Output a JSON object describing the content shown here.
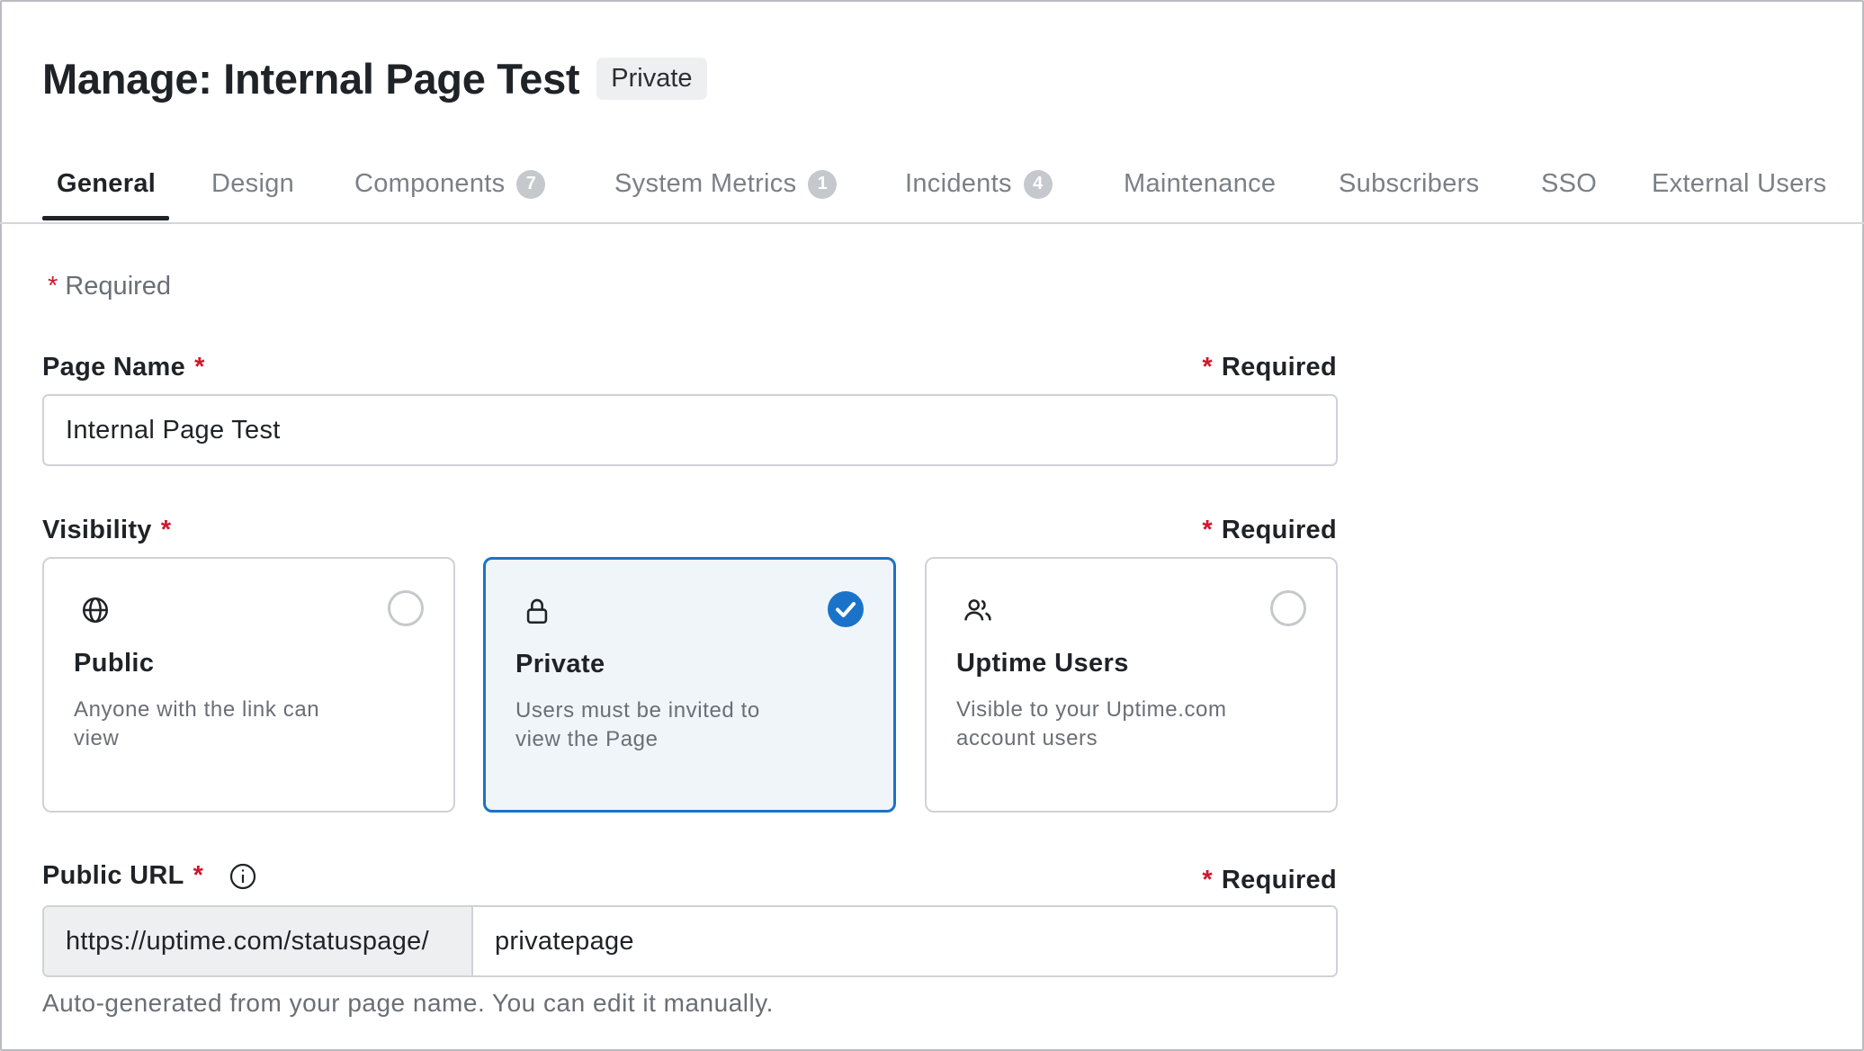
{
  "header": {
    "title": "Manage: Internal Page Test",
    "badge": "Private"
  },
  "tabs": [
    {
      "label": "General",
      "count": null,
      "active": true
    },
    {
      "label": "Design",
      "count": null
    },
    {
      "label": "Components",
      "count": "7"
    },
    {
      "label": "System Metrics",
      "count": "1"
    },
    {
      "label": "Incidents",
      "count": "4"
    },
    {
      "label": "Maintenance",
      "count": null
    },
    {
      "label": "Subscribers",
      "count": null
    },
    {
      "label": "SSO",
      "count": null
    },
    {
      "label": "External Users",
      "count": null
    }
  ],
  "form": {
    "required_note": "Required",
    "required_star": "*",
    "page_name": {
      "label": "Page Name",
      "required_text": "Required",
      "value": "Internal Page Test"
    },
    "visibility": {
      "label": "Visibility",
      "required_text": "Required",
      "options": [
        {
          "title": "Public",
          "description": "Anyone with the link can view",
          "icon": "globe-icon",
          "selected": false
        },
        {
          "title": "Private",
          "description": "Users must be invited to view the Page",
          "icon": "lock-icon",
          "selected": true
        },
        {
          "title": "Uptime Users",
          "description": "Visible to your Uptime.com account users",
          "icon": "users-icon",
          "selected": false
        }
      ]
    },
    "public_url": {
      "label": "Public URL",
      "required_text": "Required",
      "prefix": "https://uptime.com/statuspage/",
      "value": "privatepage",
      "help": "Auto-generated from your page name. You can edit it manually."
    }
  },
  "colors": {
    "accent": "#1a73c8",
    "required_star": "#d1162c",
    "muted_text": "#6a6f76",
    "tab_inactive": "#7b8087"
  }
}
